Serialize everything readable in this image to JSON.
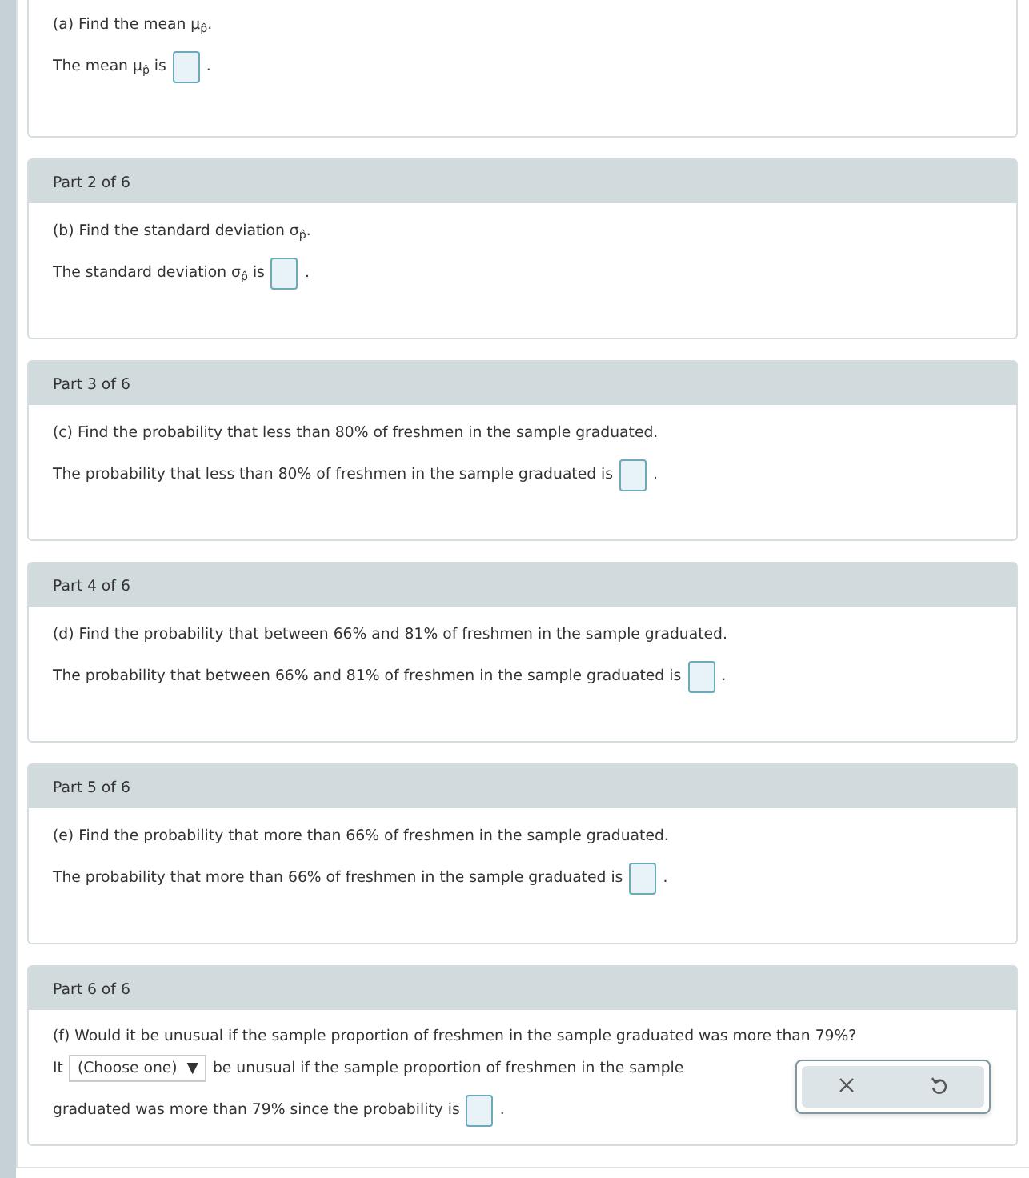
{
  "parts": [
    {
      "prompt": "(a) Find the mean μ$_{p̂}$.",
      "answer": [
        {
          "kind": "text",
          "text": "The mean μ$_{p̂}$ is"
        },
        {
          "kind": "box"
        },
        {
          "kind": "text",
          "text": "."
        }
      ]
    },
    {
      "header": "Part 2 of 6",
      "prompt": "(b) Find the standard deviation σ$_{p̂}$.",
      "answer": [
        {
          "kind": "text",
          "text": "The standard deviation σ$_{p̂}$ is"
        },
        {
          "kind": "box"
        },
        {
          "kind": "text",
          "text": "."
        }
      ]
    },
    {
      "header": "Part 3 of 6",
      "prompt": "(c) Find the probability that less than 80% of freshmen in the sample graduated.",
      "answer": [
        {
          "kind": "text",
          "text": "The probability that less than 80% of freshmen in the sample graduated is"
        },
        {
          "kind": "box"
        },
        {
          "kind": "text",
          "text": "."
        }
      ]
    },
    {
      "header": "Part 4 of 6",
      "prompt": "(d) Find the probability that between 66% and 81% of freshmen in the sample graduated.",
      "answer": [
        {
          "kind": "text",
          "text": "The probability that between 66% and 81% of freshmen in the sample graduated is"
        },
        {
          "kind": "box"
        },
        {
          "kind": "text",
          "text": "."
        }
      ]
    },
    {
      "header": "Part 5 of 6",
      "prompt": "(e) Find the probability that more than 66% of freshmen in the sample graduated.",
      "answer": [
        {
          "kind": "text",
          "text": "The probability that more than 66% of freshmen in the sample graduated is"
        },
        {
          "kind": "box"
        },
        {
          "kind": "text",
          "text": "."
        }
      ]
    },
    {
      "header": "Part 6 of 6",
      "prompt": "(f)  Would it be unusual if the sample proportion of freshmen in the sample graduated was more than 79%?",
      "answer": [
        {
          "kind": "text",
          "text": "It"
        },
        {
          "kind": "select",
          "text": "(Choose one)",
          "caret": "▼"
        },
        {
          "kind": "text",
          "text": "be unusual if the sample proportion of freshmen in the sample"
        },
        {
          "kind": "break"
        },
        {
          "kind": "text",
          "text": "graduated was more than 79% since the probability is"
        },
        {
          "kind": "box"
        },
        {
          "kind": "text",
          "text": "."
        }
      ],
      "tools": true
    }
  ]
}
